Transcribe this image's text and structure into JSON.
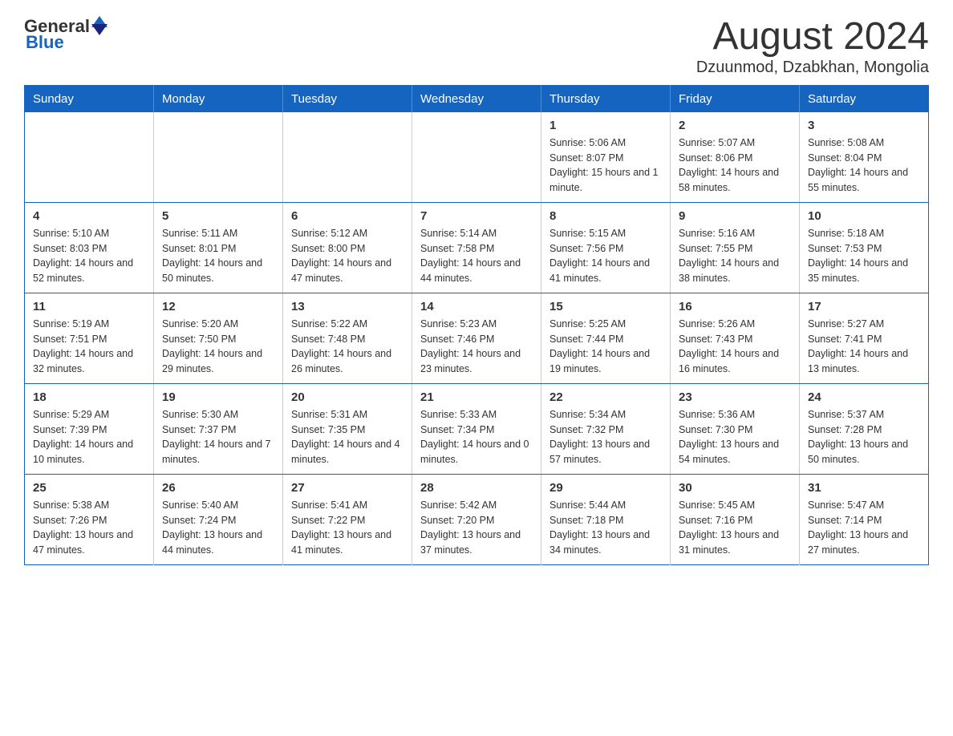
{
  "logo": {
    "general": "General",
    "blue": "Blue"
  },
  "header": {
    "month": "August 2024",
    "location": "Dzuunmod, Dzabkhan, Mongolia"
  },
  "days_of_week": [
    "Sunday",
    "Monday",
    "Tuesday",
    "Wednesday",
    "Thursday",
    "Friday",
    "Saturday"
  ],
  "weeks": [
    [
      {
        "day": "",
        "info": ""
      },
      {
        "day": "",
        "info": ""
      },
      {
        "day": "",
        "info": ""
      },
      {
        "day": "",
        "info": ""
      },
      {
        "day": "1",
        "info": "Sunrise: 5:06 AM\nSunset: 8:07 PM\nDaylight: 15 hours and 1 minute."
      },
      {
        "day": "2",
        "info": "Sunrise: 5:07 AM\nSunset: 8:06 PM\nDaylight: 14 hours and 58 minutes."
      },
      {
        "day": "3",
        "info": "Sunrise: 5:08 AM\nSunset: 8:04 PM\nDaylight: 14 hours and 55 minutes."
      }
    ],
    [
      {
        "day": "4",
        "info": "Sunrise: 5:10 AM\nSunset: 8:03 PM\nDaylight: 14 hours and 52 minutes."
      },
      {
        "day": "5",
        "info": "Sunrise: 5:11 AM\nSunset: 8:01 PM\nDaylight: 14 hours and 50 minutes."
      },
      {
        "day": "6",
        "info": "Sunrise: 5:12 AM\nSunset: 8:00 PM\nDaylight: 14 hours and 47 minutes."
      },
      {
        "day": "7",
        "info": "Sunrise: 5:14 AM\nSunset: 7:58 PM\nDaylight: 14 hours and 44 minutes."
      },
      {
        "day": "8",
        "info": "Sunrise: 5:15 AM\nSunset: 7:56 PM\nDaylight: 14 hours and 41 minutes."
      },
      {
        "day": "9",
        "info": "Sunrise: 5:16 AM\nSunset: 7:55 PM\nDaylight: 14 hours and 38 minutes."
      },
      {
        "day": "10",
        "info": "Sunrise: 5:18 AM\nSunset: 7:53 PM\nDaylight: 14 hours and 35 minutes."
      }
    ],
    [
      {
        "day": "11",
        "info": "Sunrise: 5:19 AM\nSunset: 7:51 PM\nDaylight: 14 hours and 32 minutes."
      },
      {
        "day": "12",
        "info": "Sunrise: 5:20 AM\nSunset: 7:50 PM\nDaylight: 14 hours and 29 minutes."
      },
      {
        "day": "13",
        "info": "Sunrise: 5:22 AM\nSunset: 7:48 PM\nDaylight: 14 hours and 26 minutes."
      },
      {
        "day": "14",
        "info": "Sunrise: 5:23 AM\nSunset: 7:46 PM\nDaylight: 14 hours and 23 minutes."
      },
      {
        "day": "15",
        "info": "Sunrise: 5:25 AM\nSunset: 7:44 PM\nDaylight: 14 hours and 19 minutes."
      },
      {
        "day": "16",
        "info": "Sunrise: 5:26 AM\nSunset: 7:43 PM\nDaylight: 14 hours and 16 minutes."
      },
      {
        "day": "17",
        "info": "Sunrise: 5:27 AM\nSunset: 7:41 PM\nDaylight: 14 hours and 13 minutes."
      }
    ],
    [
      {
        "day": "18",
        "info": "Sunrise: 5:29 AM\nSunset: 7:39 PM\nDaylight: 14 hours and 10 minutes."
      },
      {
        "day": "19",
        "info": "Sunrise: 5:30 AM\nSunset: 7:37 PM\nDaylight: 14 hours and 7 minutes."
      },
      {
        "day": "20",
        "info": "Sunrise: 5:31 AM\nSunset: 7:35 PM\nDaylight: 14 hours and 4 minutes."
      },
      {
        "day": "21",
        "info": "Sunrise: 5:33 AM\nSunset: 7:34 PM\nDaylight: 14 hours and 0 minutes."
      },
      {
        "day": "22",
        "info": "Sunrise: 5:34 AM\nSunset: 7:32 PM\nDaylight: 13 hours and 57 minutes."
      },
      {
        "day": "23",
        "info": "Sunrise: 5:36 AM\nSunset: 7:30 PM\nDaylight: 13 hours and 54 minutes."
      },
      {
        "day": "24",
        "info": "Sunrise: 5:37 AM\nSunset: 7:28 PM\nDaylight: 13 hours and 50 minutes."
      }
    ],
    [
      {
        "day": "25",
        "info": "Sunrise: 5:38 AM\nSunset: 7:26 PM\nDaylight: 13 hours and 47 minutes."
      },
      {
        "day": "26",
        "info": "Sunrise: 5:40 AM\nSunset: 7:24 PM\nDaylight: 13 hours and 44 minutes."
      },
      {
        "day": "27",
        "info": "Sunrise: 5:41 AM\nSunset: 7:22 PM\nDaylight: 13 hours and 41 minutes."
      },
      {
        "day": "28",
        "info": "Sunrise: 5:42 AM\nSunset: 7:20 PM\nDaylight: 13 hours and 37 minutes."
      },
      {
        "day": "29",
        "info": "Sunrise: 5:44 AM\nSunset: 7:18 PM\nDaylight: 13 hours and 34 minutes."
      },
      {
        "day": "30",
        "info": "Sunrise: 5:45 AM\nSunset: 7:16 PM\nDaylight: 13 hours and 31 minutes."
      },
      {
        "day": "31",
        "info": "Sunrise: 5:47 AM\nSunset: 7:14 PM\nDaylight: 13 hours and 27 minutes."
      }
    ]
  ]
}
